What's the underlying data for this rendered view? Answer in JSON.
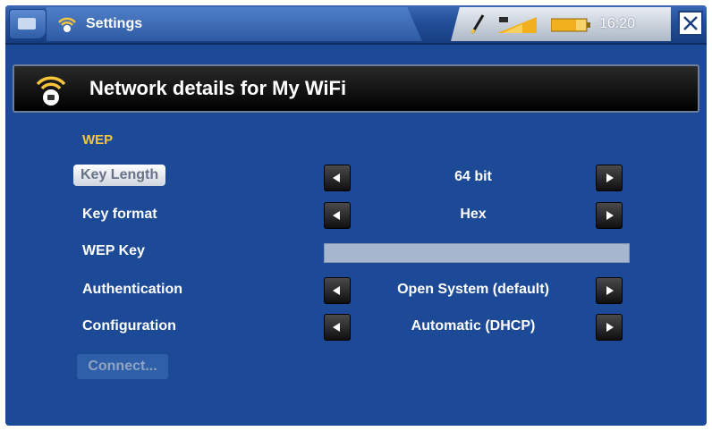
{
  "topbar": {
    "tab_title": "Settings",
    "time": "16:20",
    "icons": [
      "home-icon",
      "wifi-icon",
      "pen-icon",
      "signal-icon",
      "battery-icon",
      "close-icon"
    ]
  },
  "header": {
    "title": "Network details for My WiFi"
  },
  "section": {
    "title": "WEP"
  },
  "rows": [
    {
      "label": "Key Length",
      "value": "64 bit"
    },
    {
      "label": "Key format",
      "value": "Hex"
    },
    {
      "label": "WEP Key",
      "value": ""
    },
    {
      "label": "Authentication",
      "value": "Open System (default)"
    },
    {
      "label": "Configuration",
      "value": "Automatic (DHCP)"
    }
  ],
  "connect": {
    "label": "Connect..."
  },
  "colors": {
    "background": "#1d4a96",
    "section_title": "#f1c63a",
    "header_bg": "#000000",
    "field_bg": "#a7b6cf"
  }
}
